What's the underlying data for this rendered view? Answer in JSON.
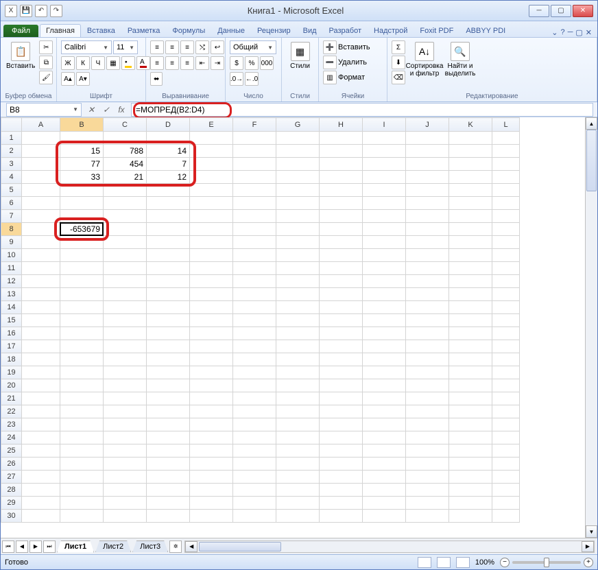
{
  "window": {
    "title": "Книга1 - Microsoft Excel"
  },
  "qat": {
    "save": "💾",
    "undo": "↶",
    "redo": "↷"
  },
  "tabs": {
    "file": "Файл",
    "items": [
      "Главная",
      "Вставка",
      "Разметка",
      "Формулы",
      "Данные",
      "Рецензир",
      "Вид",
      "Разработ",
      "Надстрой",
      "Foxit PDF",
      "ABBYY PDI"
    ],
    "active": 0
  },
  "ribbon": {
    "clipboard": {
      "label": "Буфер обмена",
      "paste": "Вставить"
    },
    "font": {
      "label": "Шрифт",
      "name": "Calibri",
      "size": "11",
      "bold": "Ж",
      "italic": "К",
      "underline": "Ч"
    },
    "alignment": {
      "label": "Выравнивание"
    },
    "number": {
      "label": "Число",
      "format": "Общий"
    },
    "styles": {
      "label": "Стили",
      "btn": "Стили"
    },
    "cells": {
      "label": "Ячейки",
      "insert": "Вставить",
      "delete": "Удалить",
      "format": "Формат"
    },
    "editing": {
      "label": "Редактирование",
      "sort": "Сортировка и фильтр",
      "find": "Найти и выделить",
      "sum": "Σ"
    }
  },
  "namebox": {
    "value": "B8"
  },
  "formula": {
    "value": "=МОПРЕД(B2:D4)"
  },
  "columns": [
    "A",
    "B",
    "C",
    "D",
    "E",
    "F",
    "G",
    "H",
    "I",
    "J",
    "K",
    "L"
  ],
  "cells": {
    "B2": "15",
    "C2": "788",
    "D2": "14",
    "B3": "77",
    "C3": "454",
    "D3": "7",
    "B4": "33",
    "C4": "21",
    "D4": "12",
    "B8": "-653679"
  },
  "selection": {
    "cell": "B8",
    "row": 8,
    "col": "B"
  },
  "sheets": {
    "items": [
      "Лист1",
      "Лист2",
      "Лист3"
    ],
    "active": 0
  },
  "status": {
    "ready": "Готово",
    "zoom": "100%"
  },
  "chart_data": {
    "type": "table",
    "title": "Matrix determinant (МОПРЕД)",
    "matrix": [
      [
        15,
        788,
        14
      ],
      [
        77,
        454,
        7
      ],
      [
        33,
        21,
        12
      ]
    ],
    "range": "B2:D4",
    "formula": "=МОПРЕД(B2:D4)",
    "result_cell": "B8",
    "result": -653679
  }
}
